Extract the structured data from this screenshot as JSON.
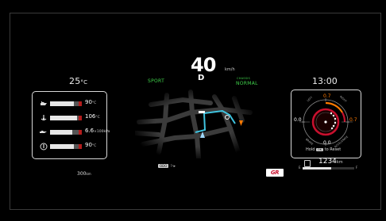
{
  "left": {
    "temp": "25",
    "temp_unit": "°C",
    "gauges": [
      {
        "icon": "engine-oil-icon",
        "glyph": "🛢",
        "value": "90",
        "unit": "°C",
        "fill": 0.75
      },
      {
        "icon": "transmission-temp-icon",
        "glyph": "⚙",
        "value": "106",
        "unit": "°C",
        "fill": 0.85
      },
      {
        "icon": "oil-pressure-icon",
        "glyph": "🛢",
        "value": "6.6",
        "unit": "×100kPa",
        "fill": 0.7
      },
      {
        "icon": "coolant-temp-icon",
        "glyph": "⊗",
        "value": "90",
        "unit": "°C",
        "fill": 0.75
      }
    ],
    "range": "300",
    "range_unit": "km"
  },
  "center": {
    "speed": "40",
    "speed_unit": "km/h",
    "gear": "D",
    "mode_left": "SPORT",
    "chassis_label": "CHASSIS",
    "mode_right": "NORMAL",
    "odo_tag": "ODO",
    "odo_text": "⚐▸"
  },
  "right": {
    "clock": "13:00",
    "g_top": "0.7",
    "g_right": "0.7",
    "g_left": "0.0",
    "g_bottom": "0.0",
    "lbl_left": "LEFT",
    "lbl_right": "RIGHT",
    "lbl_brake": "BRAKE",
    "lbl_accel": "ACCELERATE",
    "reset_prefix": "Hold",
    "reset_key": "OK",
    "reset_suffix": "to Reset",
    "fuel_value": "1234",
    "fuel_unit": "km",
    "fuel_E": "E",
    "fuel_F": "F",
    "fuel_fill": 0.55
  },
  "colors": {
    "accent_green": "#3fd14a",
    "accent_orange": "#ff7a00",
    "route": "#3fc4e0",
    "red": "#c8102e"
  },
  "logo": "GR"
}
